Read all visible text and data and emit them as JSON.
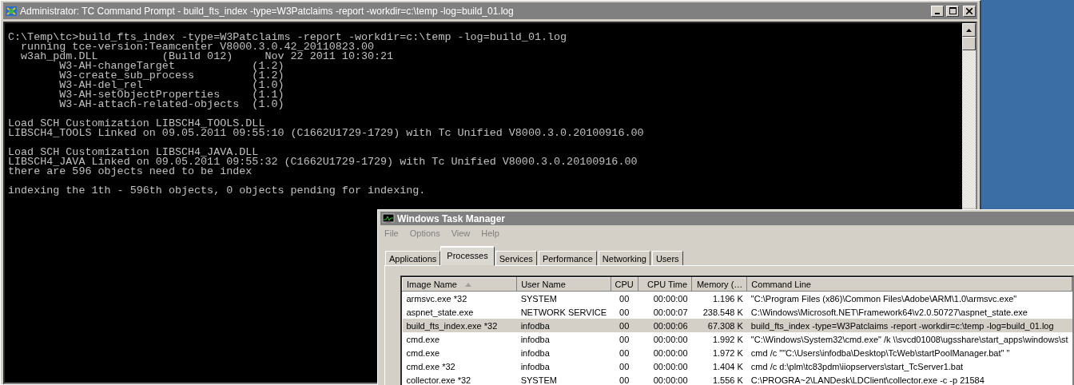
{
  "console_window": {
    "title": "Administrator: TC Command Prompt - build_fts_index  -type=W3Patclaims -report -workdir=c:\\temp -log=build_01.log",
    "blocks": [
      [
        "C:\\Temp\\tc>build_fts_index -type=W3Patclaims -report -workdir=c:\\temp -log=build_01.log",
        "  running tce-version:Teamcenter V8000.3.0.42_20110823.00",
        "  w3ah_pdm.DLL          (Build 012)     Nov 22 2011 10:30:21",
        "        W3-AH-changeTarget            (1.2)",
        "        W3-create_sub_process         (1.2)",
        "        W3-AH-del_rel                 (1.0)",
        "        W3-AH-setObjectProperties     (1.1)",
        "        W3-AH-attach-related-objects  (1.0)"
      ],
      [
        "Load SCH Customization LIBSCH4_TOOLS.DLL",
        "LIBSCH4_TOOLS Linked on 09.05.2011 09:55:10 (C1662U1729-1729) with Tc Unified V8000.3.0.20100916.00"
      ],
      [
        "Load SCH Customization LIBSCH4_JAVA.DLL",
        "LIBSCH4_JAVA Linked on 09.05.2011 09:55:32 (C1662U1729-1729) with Tc Unified V8000.3.0.20100916.00",
        "there are 596 objects need to be index"
      ],
      [
        "indexing the 1th - 596th objects, 0 objects pending for indexing."
      ]
    ]
  },
  "task_manager": {
    "title": "Windows Task Manager",
    "menu": [
      "File",
      "Options",
      "View",
      "Help"
    ],
    "tabs": [
      {
        "label": "Applications",
        "selected": false
      },
      {
        "label": "Processes",
        "selected": true
      },
      {
        "label": "Services",
        "selected": false
      },
      {
        "label": "Performance",
        "selected": false
      },
      {
        "label": "Networking",
        "selected": false
      },
      {
        "label": "Users",
        "selected": false
      }
    ],
    "columns": [
      {
        "label": "Image Name",
        "sorted": true
      },
      {
        "label": "User Name",
        "sorted": false
      },
      {
        "label": "CPU",
        "sorted": false
      },
      {
        "label": "CPU Time",
        "sorted": false
      },
      {
        "label": "Memory (…",
        "sorted": false
      },
      {
        "label": "Command Line",
        "sorted": false
      }
    ],
    "rows": [
      {
        "cells": [
          "armsvc.exe *32",
          "SYSTEM",
          "00",
          "00:00:00",
          "1.196 K",
          "\"C:\\Program Files (x86)\\Common Files\\Adobe\\ARM\\1.0\\armsvc.exe\""
        ],
        "selected": false
      },
      {
        "cells": [
          "aspnet_state.exe",
          "NETWORK SERVICE",
          "00",
          "00:00:07",
          "238.548 K",
          "C:\\Windows\\Microsoft.NET\\Framework64\\v2.0.50727\\aspnet_state.exe"
        ],
        "selected": false
      },
      {
        "cells": [
          "build_fts_index.exe *32",
          "infodba",
          "00",
          "00:00:06",
          "67.308 K",
          "build_fts_index  -type=W3Patclaims -report -workdir=c:\\temp -log=build_01.log"
        ],
        "selected": true
      },
      {
        "cells": [
          "cmd.exe",
          "infodba",
          "00",
          "00:00:00",
          "1.992 K",
          "\"C:\\Windows\\System32\\cmd.exe\" /k \\\\svcd01008\\ugsshare\\start_apps\\windows\\st"
        ],
        "selected": false
      },
      {
        "cells": [
          "cmd.exe",
          "infodba",
          "00",
          "00:00:00",
          "1.972 K",
          "cmd /c \"\"C:\\Users\\infodba\\Desktop\\TcWeb\\startPoolManager.bat\" \""
        ],
        "selected": false
      },
      {
        "cells": [
          "cmd.exe *32",
          "infodba",
          "00",
          "00:00:00",
          "1.404 K",
          "cmd /c d:\\plm\\tc83pdm\\iiopservers\\start_TcServer1.bat"
        ],
        "selected": false
      },
      {
        "cells": [
          "collector.exe *32",
          "SYSTEM",
          "00",
          "00:00:00",
          "1.556 K",
          "C:\\PROGRA~2\\LANDesk\\LDClient\\collector.exe -c -p 21584"
        ],
        "selected": false
      }
    ]
  }
}
